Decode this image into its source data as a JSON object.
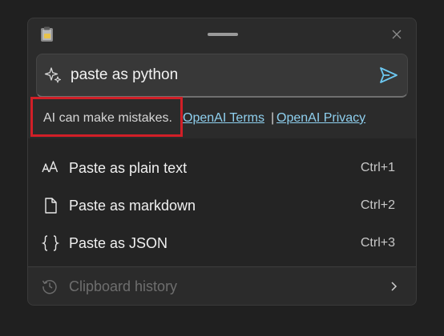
{
  "window": {
    "app_icon": "clipboard-app-icon",
    "close_icon": "close-icon"
  },
  "prompt": {
    "icon": "sparkle-icon",
    "value": "paste as python",
    "send_icon": "send-icon"
  },
  "disclaimer": {
    "text": "AI can make mistakes.",
    "terms_link": "OpenAI Terms",
    "separator": "|",
    "privacy_link": "OpenAI Privacy",
    "highlight_color": "#d11f27"
  },
  "options": [
    {
      "icon": "text-format-icon",
      "label": "Paste as plain text",
      "shortcut": "Ctrl+1"
    },
    {
      "icon": "document-icon",
      "label": "Paste as markdown",
      "shortcut": "Ctrl+2"
    },
    {
      "icon": "braces-icon",
      "label": "Paste as JSON",
      "shortcut": "Ctrl+3"
    }
  ],
  "history": {
    "icon": "history-icon",
    "label": "Clipboard history",
    "chevron_icon": "chevron-right-icon"
  },
  "colors": {
    "background": "#202020",
    "panel": "#2b2b2b",
    "link": "#8fd0ef",
    "accent": "#6cc7f0"
  }
}
